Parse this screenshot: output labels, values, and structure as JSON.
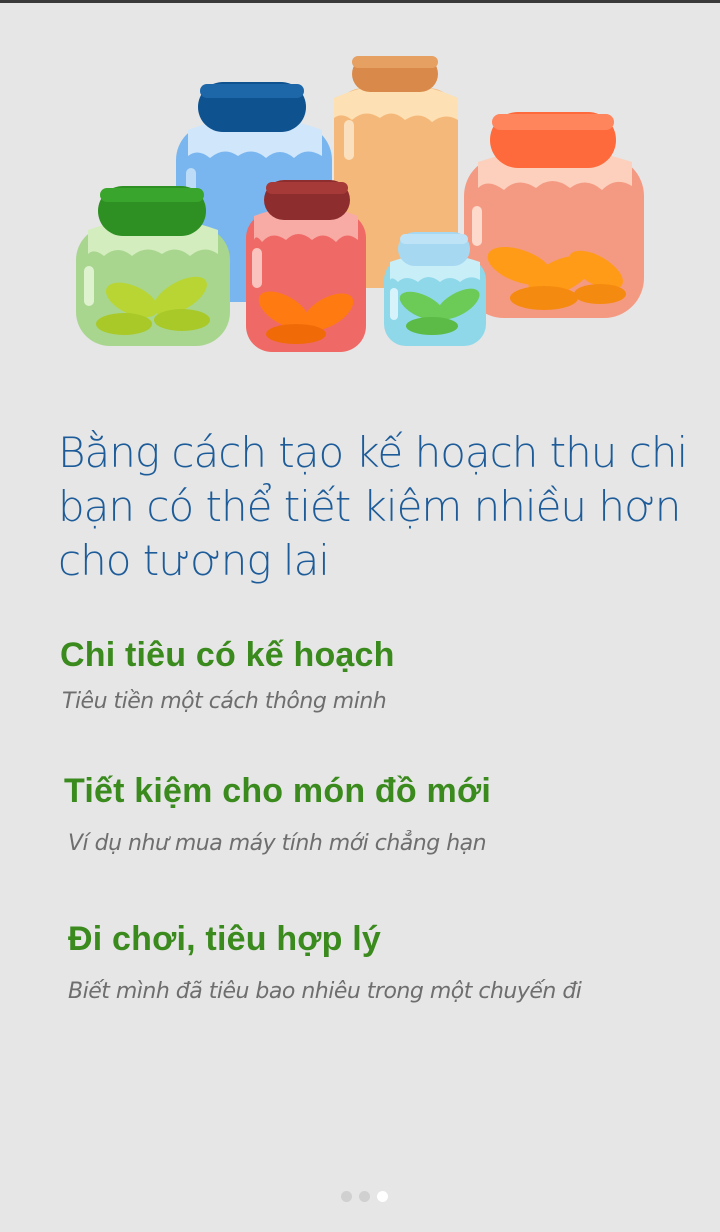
{
  "headline": "Bằng cách tạo kế hoạch thu chi bạn có thể tiết kiệm nhiều hơn cho tương lai",
  "illustration": {
    "icon": "savings-jars-illustration"
  },
  "features": [
    {
      "title": "Chi tiêu có kế hoạch",
      "subtitle": "Tiêu tiền một cách thông minh"
    },
    {
      "title": "Tiết kiệm cho món đồ mới",
      "subtitle": "Ví dụ như mua máy tính mới chẳng hạn"
    },
    {
      "title": "Đi chơi, tiêu hợp lý",
      "subtitle": "Biết mình đã tiêu bao nhiêu trong một chuyến đi"
    }
  ],
  "pager": {
    "pages": 3,
    "current": 3
  },
  "colors": {
    "background": "#e6e6e6",
    "headline": "#1d5c99",
    "feature_title": "#3a8a1e",
    "feature_subtitle": "#6e6e6e"
  }
}
